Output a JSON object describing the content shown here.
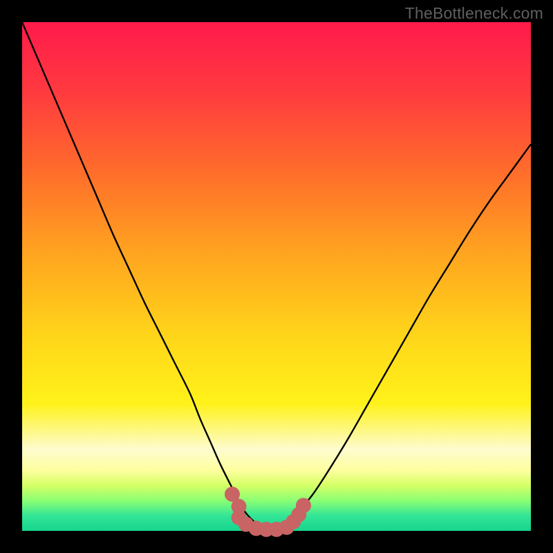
{
  "watermark": "TheBottleneck.com",
  "colors": {
    "page_bg": "#000000",
    "gradient_stops": [
      {
        "pct": 0,
        "color": "#ff1a4b"
      },
      {
        "pct": 14,
        "color": "#ff3b3f"
      },
      {
        "pct": 30,
        "color": "#ff6f2a"
      },
      {
        "pct": 46,
        "color": "#ffa61f"
      },
      {
        "pct": 62,
        "color": "#ffd61a"
      },
      {
        "pct": 75,
        "color": "#fff21a"
      },
      {
        "pct": 84,
        "color": "#fdfccf"
      },
      {
        "pct": 88,
        "color": "#feffa0"
      },
      {
        "pct": 91,
        "color": "#d6ff66"
      },
      {
        "pct": 94,
        "color": "#8cff73"
      },
      {
        "pct": 97,
        "color": "#33e597"
      },
      {
        "pct": 100,
        "color": "#16d58e"
      }
    ],
    "curve": "#000000",
    "marker_fill": "#c86464",
    "marker_stroke": "#b45050"
  },
  "chart_data": {
    "type": "line",
    "title": "",
    "xlabel": "",
    "ylabel": "",
    "xlim": [
      0,
      100
    ],
    "ylim": [
      0,
      100
    ],
    "grid": false,
    "legend": false,
    "series": [
      {
        "name": "bottleneck-curve",
        "x": [
          0,
          3,
          6,
          9,
          12,
          15,
          18,
          21,
          24,
          27,
          30,
          33,
          35,
          37,
          39,
          41,
          42.5,
          44,
          46,
          48,
          50,
          52,
          54,
          57,
          60,
          64,
          68,
          72,
          76,
          80,
          84,
          88,
          92,
          96,
          100
        ],
        "y": [
          100,
          93,
          86,
          79,
          72,
          65,
          58,
          51.5,
          45,
          39,
          33,
          27,
          22,
          17.5,
          13,
          9,
          6,
          3.5,
          1.5,
          0.5,
          0.5,
          1.5,
          3.5,
          7,
          11.5,
          18,
          25,
          32,
          39,
          46,
          52.5,
          59,
          65,
          70.5,
          76
        ]
      }
    ],
    "markers": {
      "name": "highlight-band",
      "points": [
        {
          "x": 41.3,
          "y": 7.2
        },
        {
          "x": 42.6,
          "y": 4.8
        },
        {
          "x": 42.6,
          "y": 2.6
        },
        {
          "x": 44.0,
          "y": 1.3
        },
        {
          "x": 46.0,
          "y": 0.5
        },
        {
          "x": 48.0,
          "y": 0.3
        },
        {
          "x": 50.0,
          "y": 0.3
        },
        {
          "x": 52.0,
          "y": 0.7
        },
        {
          "x": 53.3,
          "y": 1.8
        },
        {
          "x": 54.4,
          "y": 3.2
        },
        {
          "x": 55.3,
          "y": 5.0
        }
      ],
      "radius": 11
    }
  }
}
